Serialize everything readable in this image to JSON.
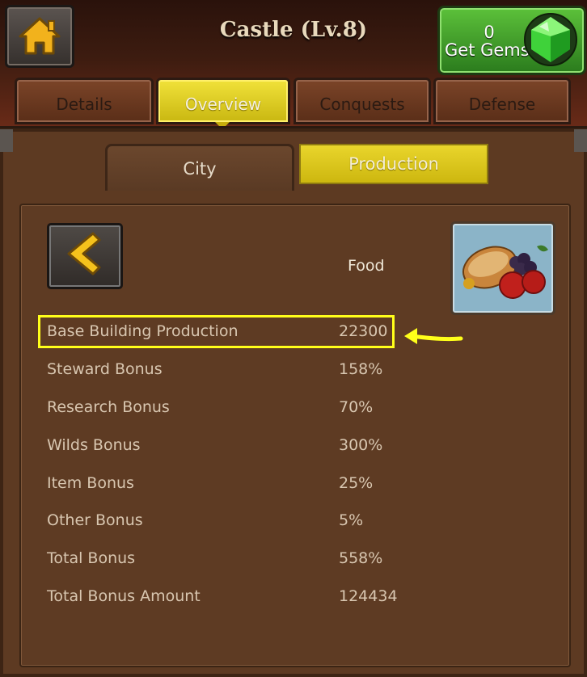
{
  "header": {
    "title": "Castle (Lv.8)",
    "gems": {
      "count": "0",
      "label": "Get Gems"
    }
  },
  "tabs": [
    {
      "label": "Details",
      "active": false
    },
    {
      "label": "Overview",
      "active": true
    },
    {
      "label": "Conquests",
      "active": false
    },
    {
      "label": "Defense",
      "active": false
    }
  ],
  "sub_tabs": [
    {
      "label": "City",
      "active": false
    },
    {
      "label": "Production",
      "active": true
    }
  ],
  "resource": {
    "name": "Food"
  },
  "rows": [
    {
      "label": "Base Building Production",
      "value": "22300",
      "highlighted": true
    },
    {
      "label": "Steward Bonus",
      "value": "158%"
    },
    {
      "label": "Research Bonus",
      "value": "70%"
    },
    {
      "label": "Wilds Bonus",
      "value": "300%"
    },
    {
      "label": "Item Bonus",
      "value": "25%"
    },
    {
      "label": "Other Bonus",
      "value": "5%"
    },
    {
      "label": "Total Bonus",
      "value": "558%"
    },
    {
      "label": "Total Bonus Amount",
      "value": "124434"
    }
  ],
  "icons": {
    "home": "home-icon",
    "gem": "gem-icon",
    "back": "chevron-left-icon",
    "food": "food-icon",
    "annotation": "arrow-left-icon"
  },
  "colors": {
    "active_tab": "#e6d320",
    "highlight_box": "#ffff1a",
    "gems_button": "#3fa82a"
  }
}
